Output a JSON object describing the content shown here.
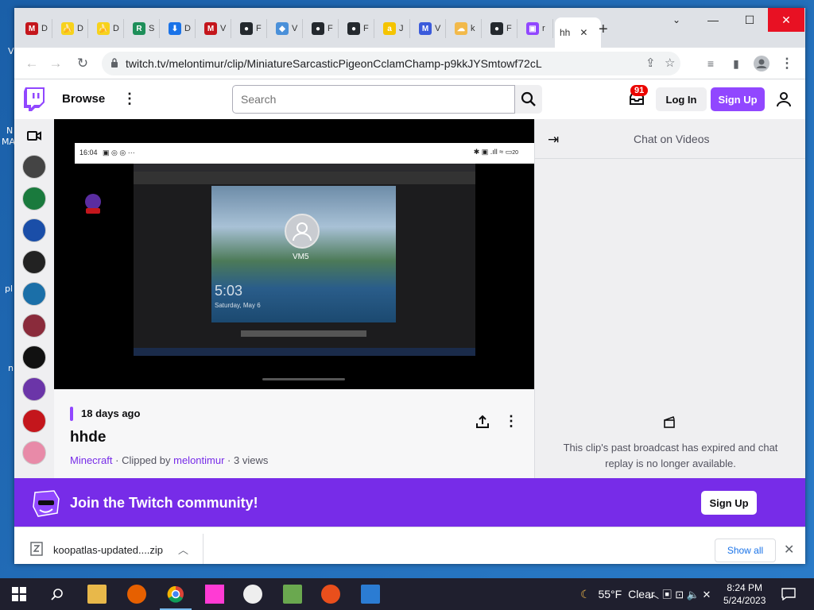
{
  "desktop": {
    "fragments": [
      "V",
      "N",
      "MA",
      "pl",
      "n"
    ]
  },
  "browser": {
    "tabs": [
      {
        "label": "D",
        "icon": "mega-icon",
        "color": "#c4161c",
        "glyph": "M"
      },
      {
        "label": "D",
        "icon": "banana-icon",
        "color": "#f7d21c",
        "glyph": "🍌"
      },
      {
        "label": "D",
        "icon": "banana-icon",
        "color": "#f7d21c",
        "glyph": "🍌"
      },
      {
        "label": "S",
        "icon": "r-icon",
        "color": "#1e8f5a",
        "glyph": "R"
      },
      {
        "label": "D",
        "icon": "download-icon",
        "color": "#1a73e8",
        "glyph": "⬇"
      },
      {
        "label": "V",
        "icon": "mega-icon",
        "color": "#c4161c",
        "glyph": "M"
      },
      {
        "label": "F",
        "icon": "github-icon",
        "color": "#24292e",
        "glyph": "●"
      },
      {
        "label": "V",
        "icon": "fish-icon",
        "color": "#4a90d9",
        "glyph": "◆"
      },
      {
        "label": "F",
        "icon": "github-icon",
        "color": "#24292e",
        "glyph": "●"
      },
      {
        "label": "F",
        "icon": "github-icon",
        "color": "#24292e",
        "glyph": "●"
      },
      {
        "label": "J",
        "icon": "a-icon",
        "color": "#f5c400",
        "glyph": "a"
      },
      {
        "label": "V",
        "icon": "m-icon",
        "color": "#3b5bdb",
        "glyph": "M"
      },
      {
        "label": "k",
        "icon": "cloud-icon",
        "color": "#f2b94a",
        "glyph": "☁"
      },
      {
        "label": "F",
        "icon": "github-icon",
        "color": "#24292e",
        "glyph": "●"
      },
      {
        "label": "r",
        "icon": "twitch-icon",
        "color": "#9147ff",
        "glyph": "▣"
      }
    ],
    "active_tab": {
      "label": "hh",
      "close": "✕"
    },
    "new_tab": "+",
    "url": "twitch.tv/melontimur/clip/MiniatureSarcasticPigeonCclamChamp-p9kkJYSmtowf72cL"
  },
  "twitch": {
    "browse": "Browse",
    "search_placeholder": "Search",
    "notif_count": "91",
    "login": "Log In",
    "signup": "Sign Up",
    "sidebar_colors": [
      "#444",
      "#1a7a3d",
      "#1a4ea8",
      "#222",
      "#1b6fa8",
      "#8a2b3b",
      "#111",
      "#6b35a8",
      "#c4161c",
      "#e88aa8"
    ],
    "clip": {
      "phone_time": "16:04",
      "phone_battery": "20",
      "vm_label": "VM5",
      "vm_time": "5:03",
      "vm_date": "Saturday, May 6",
      "ago": "18 days ago",
      "title": "hhde",
      "game": "Minecraft",
      "clipped_by_label": "Clipped by",
      "clipper": "melontimur",
      "views": "3 views",
      "dot": "·"
    },
    "chat": {
      "title": "Chat on Videos",
      "expired": "This clip's past broadcast has expired and chat replay is no longer available."
    },
    "join": {
      "text": "Join the Twitch community!",
      "button": "Sign Up"
    }
  },
  "download": {
    "filename": "koopatlas-updated....zip",
    "show_all": "Show all"
  },
  "taskbar": {
    "temp": "55°F",
    "weather": "Clear",
    "time": "8:24 PM",
    "date": "5/24/2023"
  }
}
